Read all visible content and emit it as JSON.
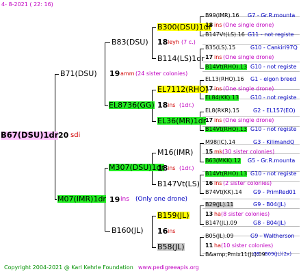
{
  "header": {
    "date": "4-  8-2021 (  22:  16)"
  },
  "footer": {
    "copyright": "Copyright 2004-2021 @ Karl Kehrle Foundation",
    "website": "www.pedigreeapis.org"
  },
  "root": {
    "id": "B67(DSU)1dr",
    "number": "20",
    "note": "sdi"
  },
  "gen1": {
    "top": {
      "id": "B71(DSU)"
    },
    "bottom": {
      "id": "M07(IMR)1dr",
      "number": "19",
      "note": "ins",
      "extra": "(Only one drone)"
    }
  },
  "gen2": [
    {
      "id": "B83(DSU)"
    },
    {
      "id": "EL8736(GG)",
      "number": "19",
      "note": "amm",
      "extra": "(24 sister colonies)"
    },
    {
      "id": "M307(DSU)1dr",
      "number": "19",
      "note": "ins"
    },
    {
      "id": "B160(JL)"
    }
  ],
  "gen3": [
    {
      "id": "B300(DSU)1dr",
      "number": "18",
      "note": "leyh",
      "extra": "(7 c.)"
    },
    {
      "id": "B114(LS)1dr"
    },
    {
      "id": "EL7112(RHO)"
    },
    {
      "id": "EL36(MR)1dr",
      "number": "18",
      "note": "ins",
      "extra": "(1dr.)"
    },
    {
      "id": "M16(IMR)"
    },
    {
      "id": "B147Vt(LS)",
      "number": "18",
      "note": "ins",
      "extra": "(1dr.)"
    },
    {
      "id": "B159(JL)"
    },
    {
      "id": "B58(JL)",
      "number": "16",
      "note": "ins"
    }
  ],
  "gen4": [
    {
      "name": "B99(IMR).16",
      "info": "G7 - Gr.R.mounta"
    },
    {
      "number": "18",
      "note": "ins",
      "extra": "(One single drone)"
    },
    {
      "name": "B147Vt(LS).16",
      "info": "G11 - not registe"
    },
    {
      "name": "B35(LS).15",
      "info": "G10 - Cankiri97Q"
    },
    {
      "number": "17",
      "note": "ins",
      "extra": "(One single drone)"
    },
    {
      "name": "B14Vt(RHO).13",
      "info": "G10 - not registe"
    },
    {
      "name": "EL13(RHO).16",
      "info": "G1 - elgon breed"
    },
    {
      "number": "17",
      "note": "ins",
      "extra": "(One single drone)"
    },
    {
      "name": "EL84(KK).13",
      "info": "G10 - not registe"
    },
    {
      "name": "EL8(RKR).15",
      "info": "G2 - EL157(EO)"
    },
    {
      "number": "17",
      "note": "ins",
      "extra": "(One single drone)"
    },
    {
      "name": "B14Vt(RHO).13",
      "info": "G10 - not registe"
    },
    {
      "name": "M98(IC).14",
      "info": "G3 - KilimandQ"
    },
    {
      "number": "15",
      "note": "mk",
      "extra": "(30 sister colonies)"
    },
    {
      "name": "B63(MKK).12",
      "info": "G5 - Gr.R.mounta"
    },
    {
      "name": "B14Vt(RHO).13",
      "info": "G10 - not registe"
    },
    {
      "number": "16",
      "note": "ins",
      "extra": "(2 sister colonies)"
    },
    {
      "name": "B74Vt(KK).14",
      "info": "G9 - PrimRed01"
    },
    {
      "name": "B29(JL).11",
      "info": "G9 - B04(JL)"
    },
    {
      "number": "13",
      "note": "ha",
      "extra": "(8 sister colonies)"
    },
    {
      "name": "B147(JL).09",
      "info": "G8 - B04(JL)"
    },
    {
      "name": "B05(JL).09",
      "info": "G9 - Waltherson"
    },
    {
      "number": "11",
      "note": "ha",
      "extra": "(10 sister colonies)"
    },
    {
      "name": "B&amp;Pmix11(JL).09",
      "info": "G9 - B09(JL)(2x)"
    }
  ]
}
